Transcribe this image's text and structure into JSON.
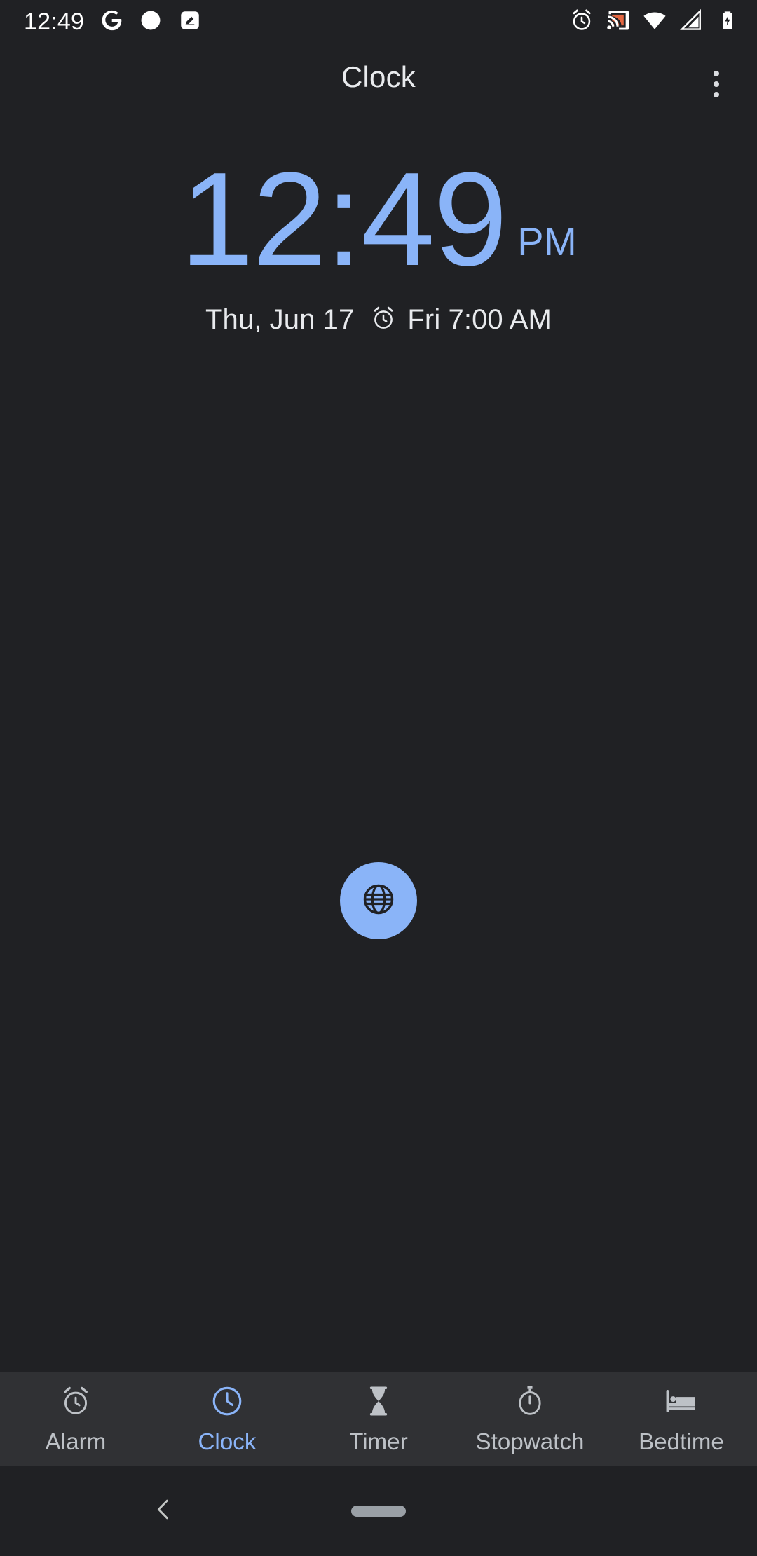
{
  "colors": {
    "background": "#202124",
    "accent": "#8ab4f8",
    "nav_background": "#303134",
    "primary_text": "#e8eaed",
    "inactive_text": "#bdc1c6",
    "cast_orange": "#ee6c45"
  },
  "status_bar": {
    "time": "12:49",
    "left_icons": [
      "google-icon",
      "circle-notification-icon",
      "square-edit-notification-icon"
    ],
    "right_icons": [
      "alarm-set-icon",
      "cast-icon",
      "wifi-icon",
      "cellular-signal-icon",
      "battery-charging-icon"
    ]
  },
  "app_bar": {
    "title": "Clock",
    "overflow_menu": "more-options"
  },
  "clock": {
    "time": "12:49",
    "am_pm": "PM",
    "date": "Thu, Jun 17",
    "next_alarm": "Fri 7:00 AM",
    "alarm_icon": "alarm-icon"
  },
  "fab": {
    "label": "world-clock",
    "icon": "globe-icon"
  },
  "bottom_nav": {
    "tabs": [
      {
        "label": "Alarm",
        "icon": "alarm-clock-icon",
        "active": false
      },
      {
        "label": "Clock",
        "icon": "clock-icon",
        "active": true
      },
      {
        "label": "Timer",
        "icon": "hourglass-icon",
        "active": false
      },
      {
        "label": "Stopwatch",
        "icon": "stopwatch-icon",
        "active": false
      },
      {
        "label": "Bedtime",
        "icon": "bed-icon",
        "active": false
      }
    ]
  },
  "system_nav": {
    "back": "back-chevron",
    "home": "home-pill"
  }
}
